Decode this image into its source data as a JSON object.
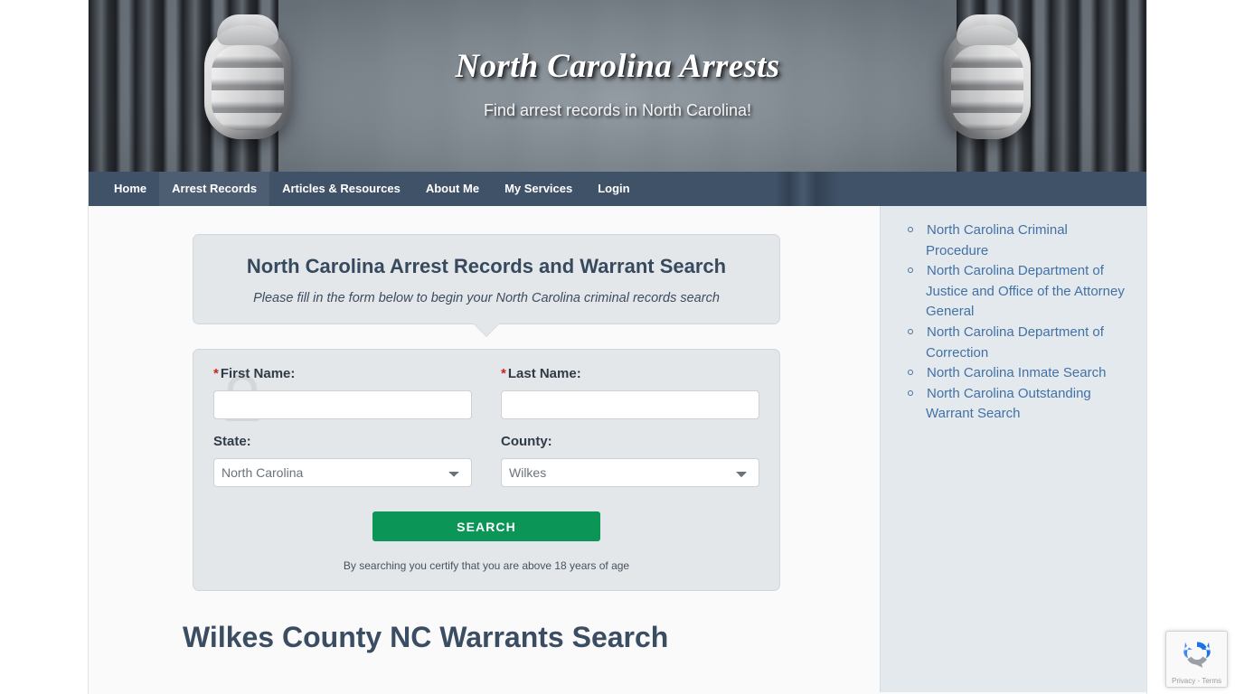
{
  "banner": {
    "site_title": "North Carolina Arrests",
    "tagline": "Find arrest records in North Carolina!"
  },
  "nav": {
    "items": [
      {
        "label": "Home",
        "active": false
      },
      {
        "label": "Arrest Records",
        "active": true
      },
      {
        "label": "Articles & Resources",
        "active": false
      },
      {
        "label": "About Me",
        "active": false
      },
      {
        "label": "My Services",
        "active": false
      },
      {
        "label": "Login",
        "active": false
      }
    ]
  },
  "callout": {
    "heading": "North Carolina Arrest Records and Warrant Search",
    "subheading": "Please fill in the form below to begin your North Carolina criminal records search"
  },
  "form": {
    "required_marker": "*",
    "first_name": {
      "label": "First Name:",
      "value": "",
      "placeholder": ""
    },
    "last_name": {
      "label": "Last Name:",
      "value": "",
      "placeholder": ""
    },
    "state": {
      "label": "State:",
      "selected": "North Carolina",
      "options": [
        "North Carolina"
      ]
    },
    "county": {
      "label": "County:",
      "selected": "Wilkes",
      "options": [
        "Wilkes"
      ]
    },
    "search_button": "SEARCH",
    "disclaimer": "By searching you certify that you are above 18 years of age",
    "watermark_icon": "padlock-icon"
  },
  "page_heading": "Wilkes County NC Warrants Search",
  "sidebar": {
    "links": [
      "North Carolina Criminal Procedure",
      "North Carolina Department of Justice and Office of the Attorney General",
      "North Carolina Department of Correction",
      "North Carolina Inmate Search",
      "North Carolina Outstanding Warrant Search"
    ]
  },
  "recaptcha": {
    "label": "Privacy - Terms",
    "icon": "recaptcha-icon"
  },
  "colors": {
    "nav_bg": "#32455d",
    "panel_bg": "#e4e7ea",
    "panel_border": "#d2d7dc",
    "heading_text": "#36495f",
    "search_button": "#0b9556",
    "link": "#4271a5",
    "sidebar_bg": "#e4e9ee",
    "required_star": "#cc2222"
  }
}
